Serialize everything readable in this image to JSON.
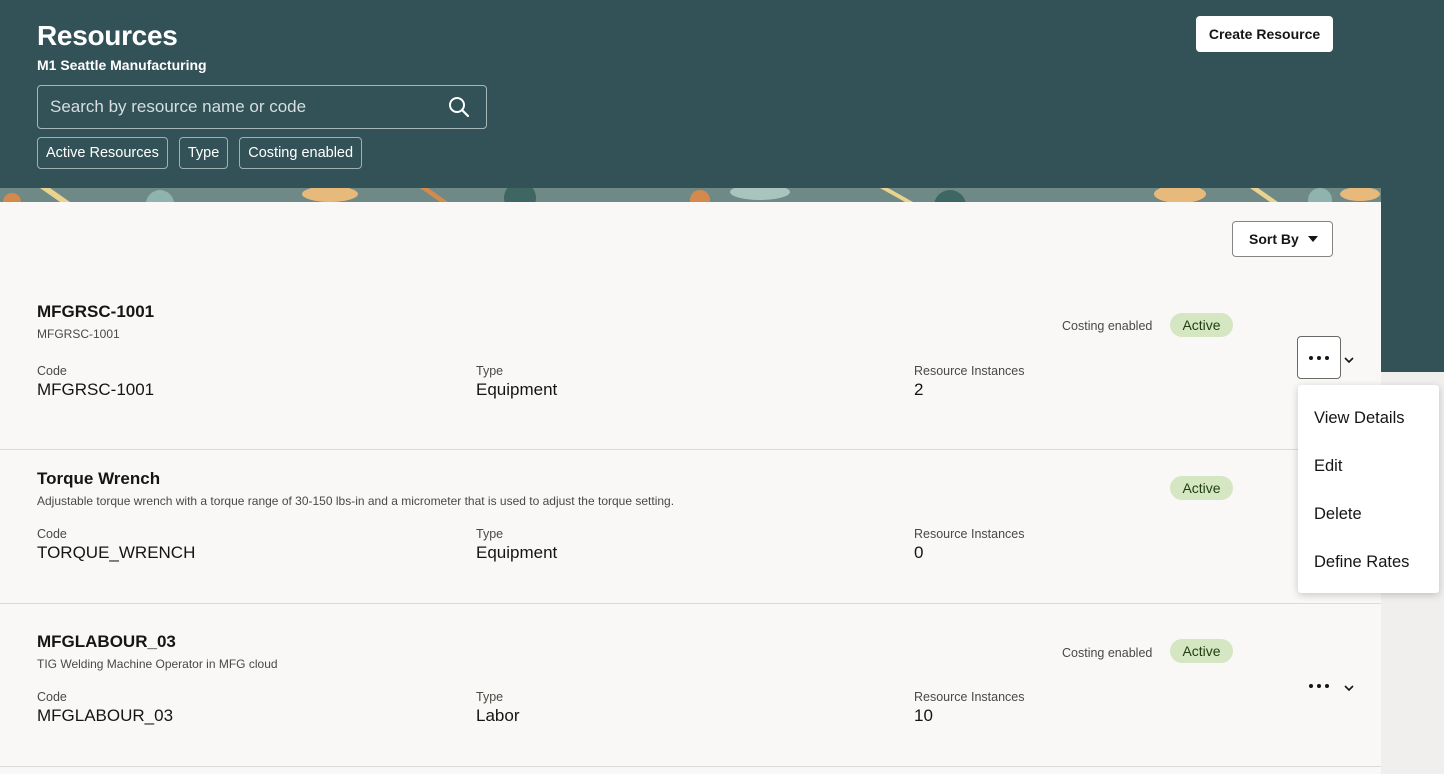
{
  "header": {
    "title": "Resources",
    "subtitle": "M1 Seattle Manufacturing",
    "create_button": "Create Resource",
    "search_placeholder": "Search by resource name or code",
    "filters": [
      "Active Resources",
      "Type",
      "Costing enabled"
    ],
    "colors": {
      "background": "#325258",
      "accent_band": [
        "#e7b97a",
        "#7fa6a2",
        "#d38a4c",
        "#e9d38f"
      ]
    }
  },
  "toolbar": {
    "sort_label": "Sort By"
  },
  "resources": [
    {
      "name": "MFGRSC-1001",
      "description": "MFGRSC-1001",
      "costing": "Costing enabled",
      "status": "Active",
      "code_label": "Code",
      "code": "MFGRSC-1001",
      "type_label": "Type",
      "type": "Equipment",
      "instances_label": "Resource Instances",
      "instances": "2"
    },
    {
      "name": "Torque Wrench",
      "description": "Adjustable torque wrench with a torque range of 30-150 lbs-in and a micrometer that is used to adjust the torque setting.",
      "costing": "",
      "status": "Active",
      "code_label": "Code",
      "code": "TORQUE_WRENCH",
      "type_label": "Type",
      "type": "Equipment",
      "instances_label": "Resource Instances",
      "instances": "0"
    },
    {
      "name": "MFGLABOUR_03",
      "description": "TIG Welding Machine Operator in MFG cloud",
      "costing": "Costing enabled",
      "status": "Active",
      "code_label": "Code",
      "code": "MFGLABOUR_03",
      "type_label": "Type",
      "type": "Labor",
      "instances_label": "Resource Instances",
      "instances": "10"
    }
  ],
  "action_menu": [
    "View Details",
    "Edit",
    "Delete",
    "Define Rates"
  ],
  "icons": {
    "search": "search-icon",
    "more": "more-actions-icon",
    "expand": "chevron-down-icon",
    "sort_caret": "caret-down-icon"
  }
}
